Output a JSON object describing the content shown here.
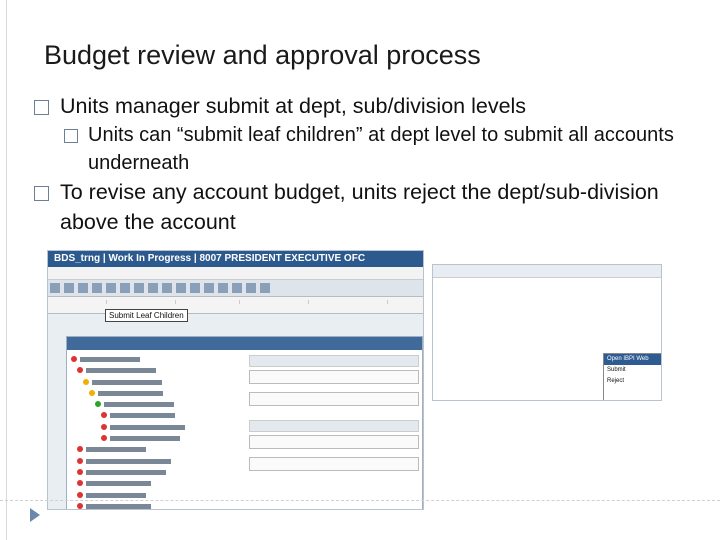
{
  "slide": {
    "title": "Budget review and approval process",
    "bullets": [
      "Units manager submit at dept, sub/division levels",
      "Units can “submit leaf children” at dept level to submit all accounts underneath",
      "To revise any account budget, units reject the dept/sub-division above the account"
    ]
  },
  "screenshot": {
    "window_title": "BDS_trng | Work In Progress | 8007 PRESIDENT EXECUTIVE OFC",
    "tooltip": "Submit Leaf Children",
    "menu": [
      "Open IBPI Web Client",
      "Submit",
      "Reject"
    ]
  }
}
